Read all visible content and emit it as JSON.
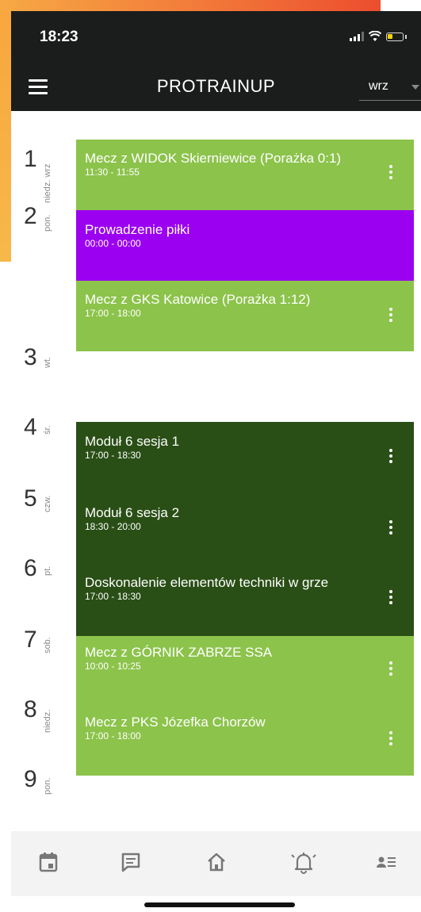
{
  "status_bar": {
    "time": "18:23"
  },
  "app_bar": {
    "title": "PROTRAINUP",
    "month": "wrz"
  },
  "days": [
    {
      "number": "1",
      "name": "niedz. wrz"
    },
    {
      "number": "2",
      "name": "pon."
    },
    {
      "number": "3",
      "name": "wt."
    },
    {
      "number": "4",
      "name": "śr."
    },
    {
      "number": "5",
      "name": "czw."
    },
    {
      "number": "6",
      "name": "pt."
    },
    {
      "number": "7",
      "name": "sob."
    },
    {
      "number": "8",
      "name": "niedz."
    },
    {
      "number": "9",
      "name": "pon."
    }
  ],
  "events": [
    {
      "title": "Mecz z WIDOK Skierniewice (Porażka 0:1)",
      "time": "11:30 - 11:55",
      "color": "#8cc34b"
    },
    {
      "title": "Prowadzenie piłki",
      "time": "00:00 - 00:00",
      "color": "#9b00f0"
    },
    {
      "title": "Mecz z GKS Katowice (Porażka 1:12)",
      "time": "17:00 - 18:00",
      "color": "#8cc34b"
    },
    {
      "title": "Moduł 6 sesja 1",
      "time": "17:00 - 18:30",
      "color": "#2a4f16"
    },
    {
      "title": "Moduł 6 sesja 2",
      "time": "18:30 - 20:00",
      "color": "#2a4f16"
    },
    {
      "title": "Doskonalenie elementów techniki w grze",
      "time": "17:00 - 18:30",
      "color": "#2a4f16"
    },
    {
      "title": "Mecz z GÓRNIK ZABRZE SSA",
      "time": "10:00 - 10:25",
      "color": "#8cc34b"
    },
    {
      "title": "Mecz z PKS Józefka Chorzów",
      "time": "17:00 - 18:00",
      "color": "#8cc34b"
    }
  ],
  "bottom_nav": {
    "items": [
      {
        "icon": "calendar-icon"
      },
      {
        "icon": "message-icon"
      },
      {
        "icon": "home-icon"
      },
      {
        "icon": "bell-icon"
      },
      {
        "icon": "profile-list-icon"
      }
    ]
  }
}
